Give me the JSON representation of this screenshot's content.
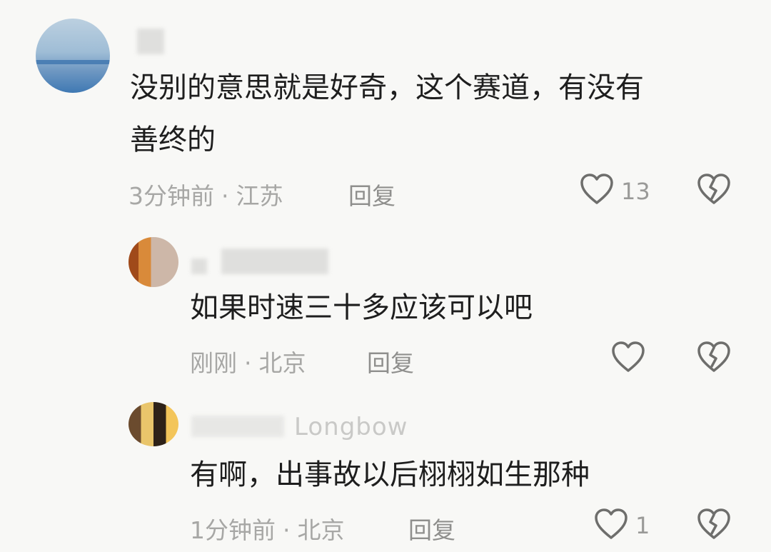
{
  "comments": [
    {
      "text_line1": "没别的意思就是好奇，这个赛道，有没有",
      "text_line2": "善终的",
      "time": "3分钟前",
      "location": "江苏",
      "reply_label": "回复",
      "like_count": "13"
    },
    {
      "text_line1": "如果时速三十多应该可以吧",
      "time": "刚刚",
      "location": "北京",
      "reply_label": "回复",
      "like_count": ""
    },
    {
      "username_visible": "Longbow",
      "text_line1": "有啊，出事故以后栩栩如生那种",
      "time": "1分钟前",
      "location": "北京",
      "reply_label": "回复",
      "like_count": "1"
    }
  ],
  "separator": "·",
  "icons": {
    "like": "heart-outline-icon",
    "dislike": "broken-heart-icon"
  },
  "colors": {
    "background": "#f8f8f6",
    "text": "#1e1e1e",
    "meta": "#a7a7a5",
    "icon": "#6e6e6c"
  }
}
